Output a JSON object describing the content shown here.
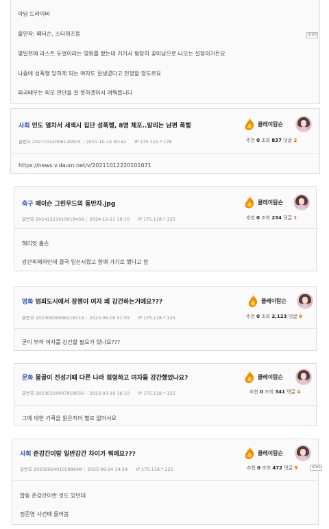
{
  "cards": [
    {
      "lines": [
        "아담 드라이버",
        "출연작: 패터슨, 스타워즈등",
        "몇일전에 라스트 듀얼이라는 영화를 봤는데 거기서 평창히 꽃미남으로 나오는 설정이거든요",
        "나중에 성폭행 당하게 되는 여자도 잘생겼다고 인정할 정도로요",
        "외국배우는 외모 판단을 잘 못하겠어서 여쭤봅니다"
      ],
      "ctrl": "(Ctrl)"
    },
    {
      "category": "사회",
      "title": "인도 열차서 세색시 집단 성폭행, 8명 체포..말리는 남편 폭행",
      "author": "클레이탐슨",
      "meta_label": "글번호",
      "post_no": "20211014006120903",
      "date": "2021-10-14 00:42",
      "ip_label": "IP",
      "ip": "175.121.*.178",
      "rec_label": "추천",
      "rec": "0",
      "view_label": "조회",
      "views": "837",
      "cmt_label": "댓글",
      "comments": "2",
      "lines": [
        "https://news.v.daum.net/v/20211012220101071"
      ]
    },
    {
      "category": "축구",
      "title": "메이슨 그린우드의 동반자.jpg",
      "author": "클레이탐슨",
      "meta_label": "글번호",
      "post_no": "20241221010019456",
      "date": "2024-12-21 19:10",
      "ip_label": "IP",
      "ip": "175.118.*.125",
      "rec_label": "추천",
      "rec": "0",
      "view_label": "조회",
      "views": "234",
      "cmt_label": "댓글",
      "comments": "1",
      "lines": [
        "해리엇 홈슨",
        "강간피해자인데 결국 임신시켰고 함께 가기로 했다고 함"
      ]
    },
    {
      "category": "영화",
      "title": "범죄도시에서 장첸이 여자 왜 강간하는거에요???",
      "author": "클레이탐슨",
      "meta_label": "글번호",
      "post_no": "20230609008218119",
      "date": "2023-06-09 01:55",
      "ip_label": "IP",
      "ip": "175.118.*.125",
      "rec_label": "추천",
      "rec": "0",
      "view_label": "조회",
      "views": "2,123",
      "cmt_label": "댓글",
      "comments": "9",
      "lines": [
        "굳이 부하 여자를 강간할 필요가 있나요???"
      ]
    },
    {
      "category": "문화",
      "title": "몽골이 전성기때 다른 나라 점령하고 여자들 강간했었나요?",
      "author": "클레이탐슨",
      "meta_label": "글번호",
      "post_no": "20230319007918056",
      "date": "2023-03-19 16:10",
      "ip_label": "IP",
      "ip": "175.118.*.125",
      "rec_label": "추천",
      "rec": "0",
      "view_label": "조회",
      "views": "341",
      "cmt_label": "댓글",
      "comments": "4",
      "lines": [
        "그에 대한 기록을 읽은적이 별로 없어서요"
      ]
    },
    {
      "category": "사회",
      "title": "준강간이랑 일반강간 차이가 뭐에요???",
      "author": "클레이탐슨",
      "meta_label": "글번호",
      "post_no": "20250624010589648",
      "date": "2025-06-24 19:24",
      "ip_label": "IP",
      "ip": "175.118.*.125",
      "rec_label": "추천",
      "rec": "0",
      "view_label": "조회",
      "views": "472",
      "cmt_label": "댓글",
      "comments": "9",
      "lines": [
        "합동 준강간이란 것도 있던데",
        "정준영 사건때 들어봄"
      ],
      "ctrl": "(Ctrl)"
    }
  ],
  "colors": {
    "category": "#2a56b0",
    "comment_count": "#d46b08",
    "card_bg": "#fafafa",
    "border": "#dcdcdc"
  },
  "icons": {
    "level": "flame-level-icon",
    "avatar": "user-avatar",
    "paste": "paste-options-icon"
  }
}
